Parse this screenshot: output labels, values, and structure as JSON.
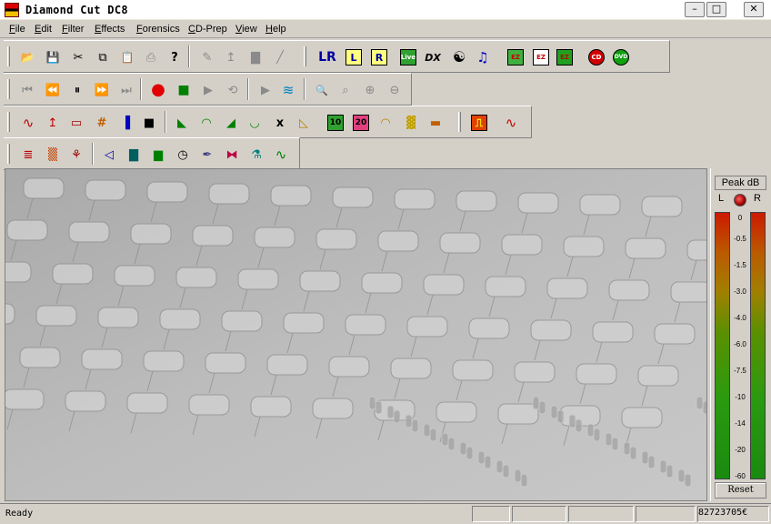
{
  "window": {
    "title": "Diamond Cut DC8",
    "minimize_label": "–",
    "maximize_label": "□",
    "close_label": "✕"
  },
  "menu": [
    "File",
    "Edit",
    "Filter",
    "Effects",
    "Forensics",
    "CD-Prep",
    "View",
    "Help"
  ],
  "toolbars": {
    "file_row": [
      {
        "name": "open-icon",
        "glyph": "📂"
      },
      {
        "name": "save-icon",
        "glyph": "💾"
      },
      {
        "name": "cut-icon",
        "glyph": "✂"
      },
      {
        "name": "copy-icon",
        "glyph": "⧉"
      },
      {
        "name": "paste-icon",
        "glyph": "📋"
      },
      {
        "name": "print-icon",
        "glyph": "⎙"
      },
      {
        "name": "help-icon",
        "glyph": "?"
      },
      {
        "name": "pencil-icon",
        "glyph": "✎"
      },
      {
        "name": "level-tool-icon",
        "glyph": "↥"
      },
      {
        "name": "envelope-tool-icon",
        "glyph": "▇"
      },
      {
        "name": "brush-icon",
        "glyph": "╱"
      },
      {
        "name": "lr-channels-icon",
        "glyph": "LR"
      },
      {
        "name": "left-channel-icon",
        "glyph": "L"
      },
      {
        "name": "right-channel-icon",
        "glyph": "R"
      },
      {
        "name": "live-icon",
        "glyph": "Live"
      },
      {
        "name": "dx-plugin-icon",
        "glyph": "DX"
      },
      {
        "name": "yin-yang-icon",
        "glyph": "☯"
      },
      {
        "name": "playlist-icon",
        "glyph": "♫"
      },
      {
        "name": "ez-clean-icon",
        "glyph": "EZ"
      },
      {
        "name": "ez-declick-icon",
        "glyph": "EZ"
      },
      {
        "name": "ez-boost-icon",
        "glyph": "EZ"
      },
      {
        "name": "cd-icon",
        "glyph": "CD"
      },
      {
        "name": "dvd-icon",
        "glyph": "DVD"
      }
    ],
    "transport_row": [
      {
        "name": "go-to-start-icon",
        "glyph": "⏮"
      },
      {
        "name": "rewind-icon",
        "glyph": "⏪"
      },
      {
        "name": "pause-icon",
        "glyph": "⏸"
      },
      {
        "name": "fast-forward-icon",
        "glyph": "⏩"
      },
      {
        "name": "go-to-end-icon",
        "glyph": "⏭"
      },
      {
        "name": "record-icon",
        "glyph": "●"
      },
      {
        "name": "stop-icon",
        "glyph": "■"
      },
      {
        "name": "play-icon",
        "glyph": "▶"
      },
      {
        "name": "loop-icon",
        "glyph": "⟲"
      },
      {
        "name": "play-selection-icon",
        "glyph": "▶"
      },
      {
        "name": "wave-preview-icon",
        "glyph": "≋"
      },
      {
        "name": "zoom-icon",
        "glyph": "🔍"
      },
      {
        "name": "zoom-fit-icon",
        "glyph": "⌕"
      },
      {
        "name": "zoom-in-icon",
        "glyph": "⊕"
      },
      {
        "name": "zoom-out-icon",
        "glyph": "⊖"
      }
    ],
    "filter_row": [
      {
        "name": "waveform-filter-icon",
        "glyph": "∿"
      },
      {
        "name": "impulse-filter-icon",
        "glyph": "↥"
      },
      {
        "name": "scope-icon",
        "glyph": "▭"
      },
      {
        "name": "grid-filter-icon",
        "glyph": "#"
      },
      {
        "name": "spectrum-icon",
        "glyph": "▐"
      },
      {
        "name": "meter-icon",
        "glyph": "■"
      },
      {
        "name": "low-shelf-icon",
        "glyph": "◣"
      },
      {
        "name": "bandpass-icon",
        "glyph": "◠"
      },
      {
        "name": "high-shelf-icon",
        "glyph": "◢"
      },
      {
        "name": "notch-icon",
        "glyph": "◡"
      },
      {
        "name": "cut-marker-icon",
        "glyph": "x"
      },
      {
        "name": "fade-icon",
        "glyph": "◺"
      },
      {
        "name": "eq-10-band-icon",
        "glyph": "10"
      },
      {
        "name": "eq-20-band-icon",
        "glyph": "20"
      },
      {
        "name": "reverb-icon",
        "glyph": "◠"
      },
      {
        "name": "routing-icon",
        "glyph": "▓"
      },
      {
        "name": "spectrogram-icon",
        "glyph": "▬"
      },
      {
        "name": "square-wave-icon",
        "glyph": "⎍"
      },
      {
        "name": "sine-wave-icon",
        "glyph": "∿"
      }
    ],
    "effects_row": [
      {
        "name": "noise-icon",
        "glyph": "≣"
      },
      {
        "name": "dehiss-icon",
        "glyph": "▒"
      },
      {
        "name": "declick-icon",
        "glyph": "⚘"
      },
      {
        "name": "speaker-icon",
        "glyph": "◁"
      },
      {
        "name": "tube-icon",
        "glyph": "▇"
      },
      {
        "name": "mixer-icon",
        "glyph": "▆"
      },
      {
        "name": "timer-icon",
        "glyph": "◷"
      },
      {
        "name": "pen-tool-icon",
        "glyph": "✒"
      },
      {
        "name": "bowtie-icon",
        "glyph": "⧓"
      },
      {
        "name": "flask-icon",
        "glyph": "⚗"
      },
      {
        "name": "sine-check-icon",
        "glyph": "∿"
      }
    ]
  },
  "meter": {
    "title": "Peak dB",
    "left_label": "L",
    "right_label": "R",
    "scale": [
      "0",
      "-0.5",
      "-1.5",
      "-3.0",
      "-4.0",
      "-6.0",
      "-7.5",
      "-10",
      "-14",
      "-20",
      "-60"
    ],
    "reset_label": "Reset"
  },
  "status": {
    "text": "Ready",
    "counter": "82723705€"
  }
}
